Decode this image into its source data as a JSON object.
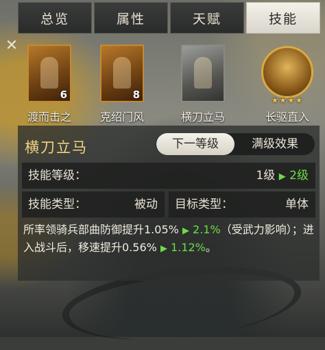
{
  "tabs": [
    "总览",
    "属性",
    "天赋",
    "技能"
  ],
  "close_glyph": "✕",
  "skills": [
    {
      "name": "渡而击之",
      "level": "6",
      "style": "orange"
    },
    {
      "name": "克绍门风",
      "level": "8",
      "style": "orange"
    },
    {
      "name": "横刀立马",
      "level": "",
      "style": "gray"
    },
    {
      "name": "长驱直入",
      "level": "",
      "style": "round",
      "stars": "★★★★"
    }
  ],
  "detail": {
    "title": "横刀立马",
    "toggle_next": "下一等级",
    "toggle_max": "满级效果",
    "skill_level_label": "技能等级：",
    "level_current": "1级",
    "level_next": "2级",
    "type_label": "技能类型：",
    "type_value": "被动",
    "target_label": "目标类型：",
    "target_value": "单体",
    "desc_part1": "所率领骑兵部曲防御提升1.05%",
    "desc_val1": "2.1%",
    "desc_part2": "（受武力影响）；进入战斗后，移速提升0.56%",
    "desc_val2": "1.12%",
    "desc_part3": "。"
  },
  "colors": {
    "title": "#f0d383",
    "upgrade": "#6fdc4a"
  }
}
